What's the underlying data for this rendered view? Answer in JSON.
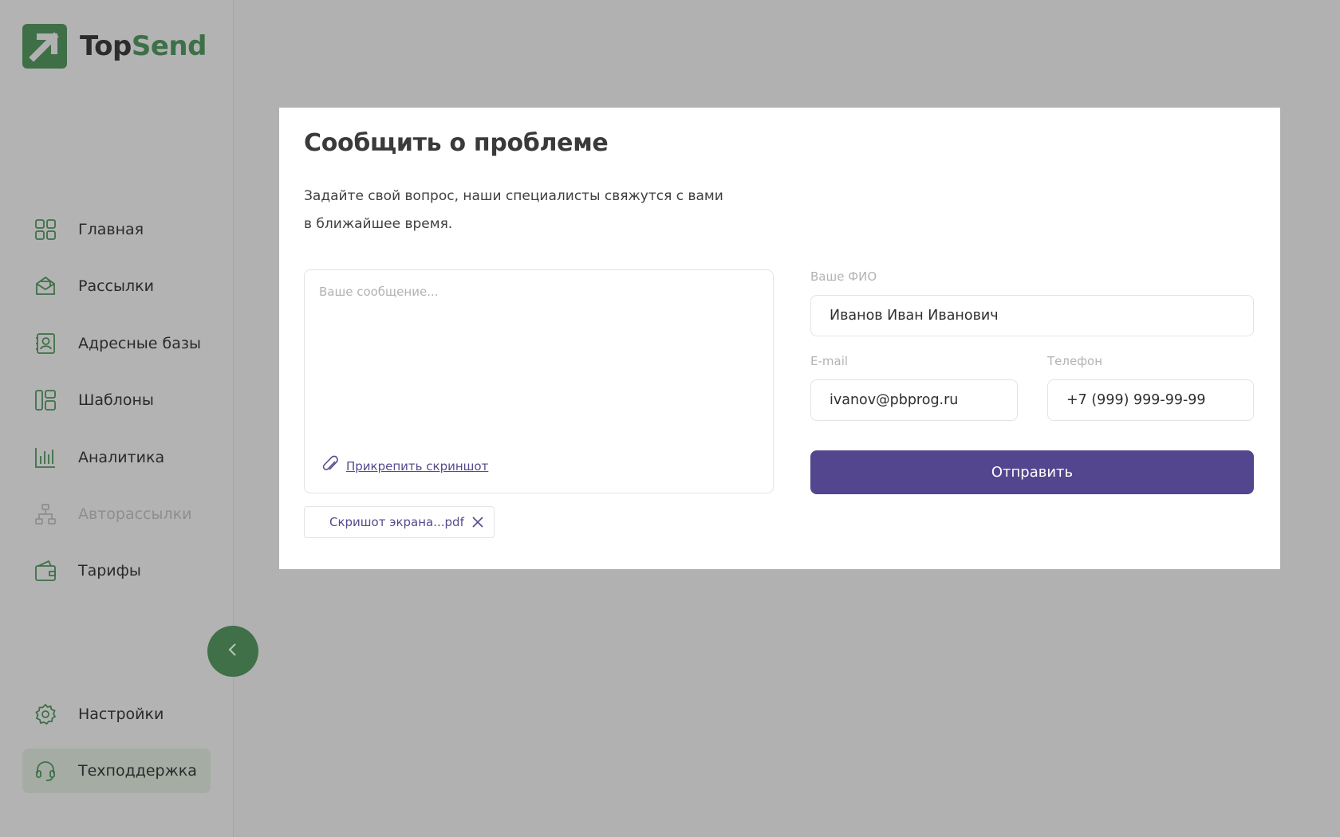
{
  "app": {
    "logo_part1": "Top",
    "logo_part2": "Send"
  },
  "sidebar": {
    "items": [
      {
        "label": "Главная",
        "icon": "grid-icon"
      },
      {
        "label": "Рассылки",
        "icon": "mail-icon"
      },
      {
        "label": "Адресные базы",
        "icon": "contacts-icon"
      },
      {
        "label": "Шаблоны",
        "icon": "layout-icon"
      },
      {
        "label": "Аналитика",
        "icon": "chart-icon"
      },
      {
        "label": "Авторассылки",
        "icon": "hierarchy-icon",
        "disabled": true
      },
      {
        "label": "Тарифы",
        "icon": "wallet-icon"
      }
    ],
    "bottom_items": [
      {
        "label": "Настройки",
        "icon": "gear-icon"
      },
      {
        "label": "Техподдержка",
        "icon": "headset-icon",
        "active": true
      }
    ],
    "collapse_icon": "chevron-left-icon"
  },
  "modal": {
    "title": "Сообщить о проблеме",
    "description_line1": "Задайте свой вопрос, наши специалисты свяжутся с вами",
    "description_line2": "в ближайшее время.",
    "message_placeholder": "Ваше сообщение...",
    "attach_label": "Прикрепить скриншот",
    "attachment_name": "Скришот экрана...pdf",
    "fullname_label": "Ваше ФИО",
    "fullname_value": "Иванов Иван Иванович",
    "email_label": "E-mail",
    "email_value": "ivanov@pbprog.ru",
    "phone_label": "Телефон",
    "phone_value": "+7 (999) 999-99-99",
    "submit_label": "Отправить"
  },
  "colors": {
    "brand_green": "#3f7048",
    "primary_purple": "#53468f",
    "overlay": "#b1b1b1"
  }
}
